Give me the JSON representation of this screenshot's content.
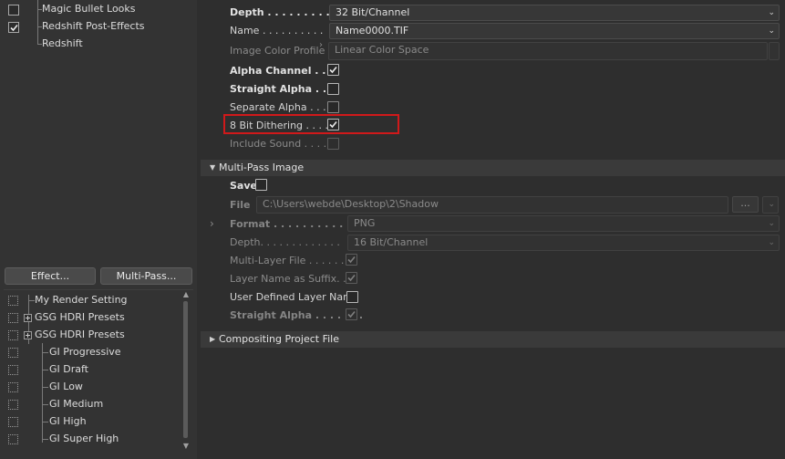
{
  "post_effects": [
    {
      "label": "Magic Bullet Looks",
      "checked": false
    },
    {
      "label": "Redshift Post-Effects",
      "checked": true
    },
    {
      "label": "Redshift",
      "checked": null
    }
  ],
  "buttons": {
    "effect": "Effect...",
    "multipass": "Multi-Pass..."
  },
  "render_settings": [
    {
      "label": "My Render Setting"
    },
    {
      "label": "GSG HDRI Presets"
    },
    {
      "label": "GSG HDRI Presets"
    },
    {
      "label": "GI Progressive"
    },
    {
      "label": "GI Draft"
    },
    {
      "label": "GI Low"
    },
    {
      "label": "GI Medium"
    },
    {
      "label": "GI High"
    },
    {
      "label": "GI Super High"
    }
  ],
  "save": {
    "depth_label": "Depth . . . . . . . . .",
    "depth_value": "32 Bit/Channel",
    "name_label": "Name . . . . . . . . . .",
    "name_value": "Name0000.TIF",
    "color_profile_label": "Image Color Profile",
    "color_profile_value": "Linear Color Space",
    "alpha_channel_label": "Alpha Channel . . .",
    "alpha_channel_checked": true,
    "straight_alpha_label": "Straight Alpha . . .",
    "straight_alpha_checked": false,
    "separate_alpha_label": "Separate Alpha . . .",
    "separate_alpha_checked": false,
    "dithering_label": "8 Bit Dithering . . . .",
    "dithering_checked": true,
    "include_sound_label": "Include Sound . . . .",
    "include_sound_checked": false
  },
  "multipass": {
    "section_title": "Multi-Pass Image",
    "save_label": "Save",
    "save_checked": false,
    "file_label": "File",
    "file_value": "C:\\Users\\webde\\Desktop\\2\\Shadow",
    "file_browse": "...",
    "format_label": "Format . . . . . . . . . . .",
    "format_value": "PNG",
    "depth_label": "Depth. . . . . . . . . . . . .",
    "depth_value": "16 Bit/Channel",
    "multilayer_label": "Multi-Layer File . . . . . .",
    "multilayer_checked": true,
    "layer_name_label": "Layer Name as Suffix. . .",
    "layer_name_checked": true,
    "user_defined_label": "User Defined Layer Name",
    "user_defined_checked": false,
    "straight_alpha_label": "Straight Alpha . . . . . . .",
    "straight_alpha_checked": true
  },
  "compositing": {
    "section_title": "Compositing Project File"
  },
  "colors": {
    "highlight": "#d0191a",
    "panel": "#2e2e2e",
    "accent_text": "#e2e2e2"
  }
}
